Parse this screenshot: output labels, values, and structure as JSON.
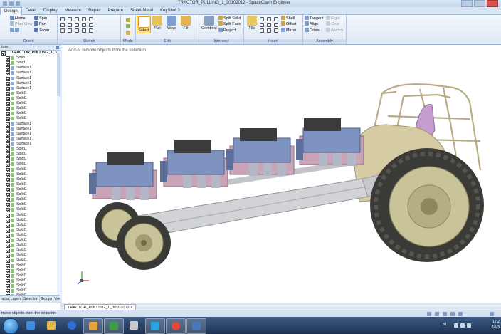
{
  "window": {
    "title": "TRACTOR_PULLING_1_30102012 - SpaceClaim Engineer"
  },
  "tabs": [
    "Design",
    "Detail",
    "Display",
    "Measure",
    "Repair",
    "Prepare",
    "Sheet Metal",
    "KeyShot 3"
  ],
  "active_tab": "Design",
  "ribbon": {
    "groups": [
      "Orient",
      "Sketch",
      "Mode",
      "Edit",
      "Intersect",
      "Insert",
      "Assembly"
    ],
    "orient": {
      "home": "Home",
      "spin": "Spin",
      "plan_view": "Plan View",
      "pan": "Pan",
      "zoom": "Zoom"
    },
    "edit": {
      "select": "Select",
      "pull": "Pull",
      "move": "Move",
      "fill": "Fill"
    },
    "intersect": {
      "combine": "Combine",
      "split_solid": "Split Solid",
      "split_face": "Split Face",
      "project": "Project"
    },
    "insert": {
      "file": "File",
      "shell": "Shell",
      "offset": "Offset",
      "mirror": "Mirror"
    },
    "assembly": {
      "tangent": "Tangent",
      "align": "Align",
      "orient": "Orient",
      "rigid": "Rigid",
      "gear": "Gear",
      "anchor": "Anchor"
    }
  },
  "structure_panel": {
    "header": "ture",
    "root": "TRACTOR_PULLING_1_3",
    "items": [
      "Solid1",
      "Solid",
      "Surface1",
      "Surface1",
      "Surface1",
      "Surface1",
      "Surface1",
      "Solid1",
      "Solid1",
      "Solid1",
      "Solid1",
      "Solid1",
      "Solid1",
      "Surface1",
      "Surface1",
      "Surface1",
      "Surface1",
      "Surface1",
      "Solid1",
      "Solid1",
      "Solid1",
      "Solid1",
      "Solid1",
      "Solid1",
      "Solid1",
      "Solid1",
      "Solid1",
      "Solid1",
      "Solid1",
      "Solid1",
      "Solid1",
      "Solid1",
      "Solid1",
      "Solid1",
      "Solid1",
      "Solid1",
      "Solid1",
      "Solid1",
      "Solid1",
      "Solid1",
      "Solid1",
      "Solid1",
      "Solid1",
      "Solid1",
      "Solid1",
      "Solid1",
      "Solid1",
      "Solid1"
    ],
    "tabs": [
      "ructu",
      "Layers",
      "Selection",
      "Groups",
      "Views"
    ]
  },
  "viewport": {
    "hint": "Add or remove objects from the selection"
  },
  "document_tab": "TRACTOR_PULLING_1_30102012",
  "status": {
    "text": "move objects from the selection"
  },
  "taskbar": {
    "lang": "NL",
    "time": "11:2",
    "date": "10/3"
  },
  "colors": {
    "accent": "#ffe08a",
    "ribbon_bg": "#dfe9f6",
    "taskbar_bg": "#1d3252",
    "engine_blue": "#7f93c0",
    "engine_pink": "#c9a3b6",
    "tire": "#3a3a36",
    "rim": "#c9c39a",
    "frame": "#c7c9cc"
  }
}
